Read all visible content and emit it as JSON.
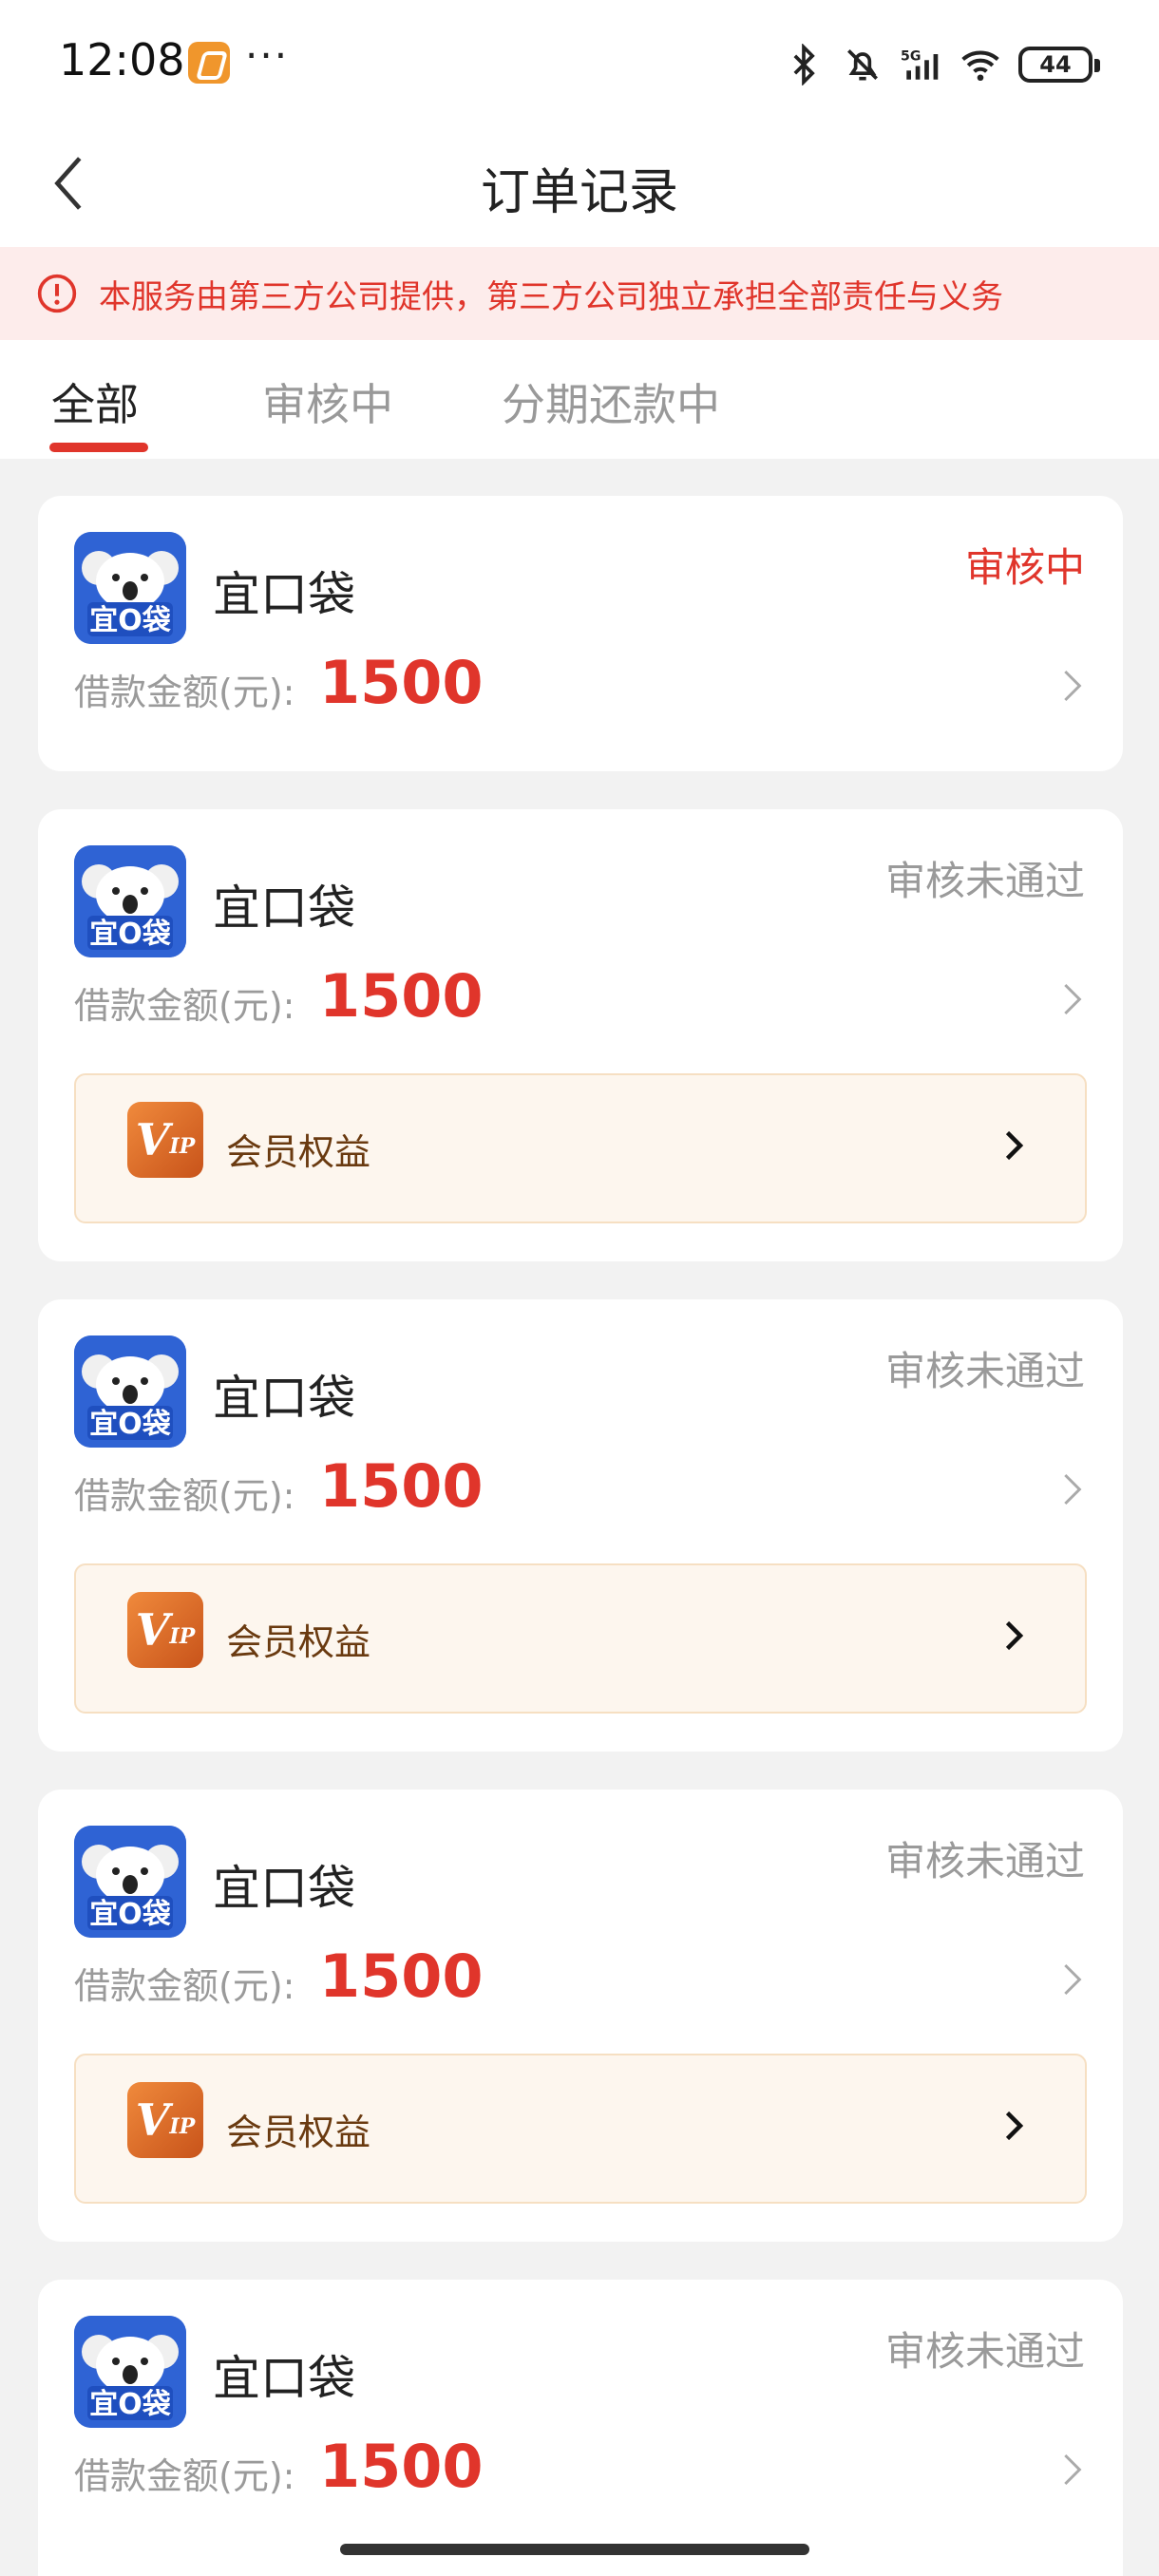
{
  "status_bar": {
    "time": "12:08",
    "dots": "···",
    "battery": "44"
  },
  "header": {
    "title": "订单记录"
  },
  "notice": {
    "text": "本服务由第三方公司提供，第三方公司独立承担全部责任与义务"
  },
  "tabs": [
    {
      "label": "全部",
      "active": true
    },
    {
      "label": "审核中",
      "active": false
    },
    {
      "label": "分期还款中",
      "active": false
    }
  ],
  "orders": [
    {
      "logo_text": "宜O袋",
      "name": "宜口袋",
      "status": "审核中",
      "status_color": "#e0352b",
      "amount_label": "借款金额(元):",
      "amount": "1500",
      "vip_label": null
    },
    {
      "logo_text": "宜O袋",
      "name": "宜口袋",
      "status": "审核未通过",
      "status_color": "#9a9a9a",
      "amount_label": "借款金额(元):",
      "amount": "1500",
      "vip_label": "会员权益"
    },
    {
      "logo_text": "宜O袋",
      "name": "宜口袋",
      "status": "审核未通过",
      "status_color": "#9a9a9a",
      "amount_label": "借款金额(元):",
      "amount": "1500",
      "vip_label": "会员权益"
    },
    {
      "logo_text": "宜O袋",
      "name": "宜口袋",
      "status": "审核未通过",
      "status_color": "#9a9a9a",
      "amount_label": "借款金额(元):",
      "amount": "1500",
      "vip_label": "会员权益"
    },
    {
      "logo_text": "宜O袋",
      "name": "宜口袋",
      "status": "审核未通过",
      "status_color": "#9a9a9a",
      "amount_label": "借款金额(元):",
      "amount": "1500",
      "vip_label": null
    }
  ],
  "vip_badge": {
    "big": "V",
    "small": "IP"
  },
  "icons": {
    "back": "chevron-left-icon",
    "notice": "alert-circle-icon",
    "row_arrow": "chevron-right-icon",
    "vip_arrow": "chevron-right-icon"
  },
  "colors": {
    "accent": "#e0352b",
    "notice_bg": "#fdeceb",
    "vip_bg": "#fdf6ee",
    "logo_bg": "#2f63d4"
  }
}
